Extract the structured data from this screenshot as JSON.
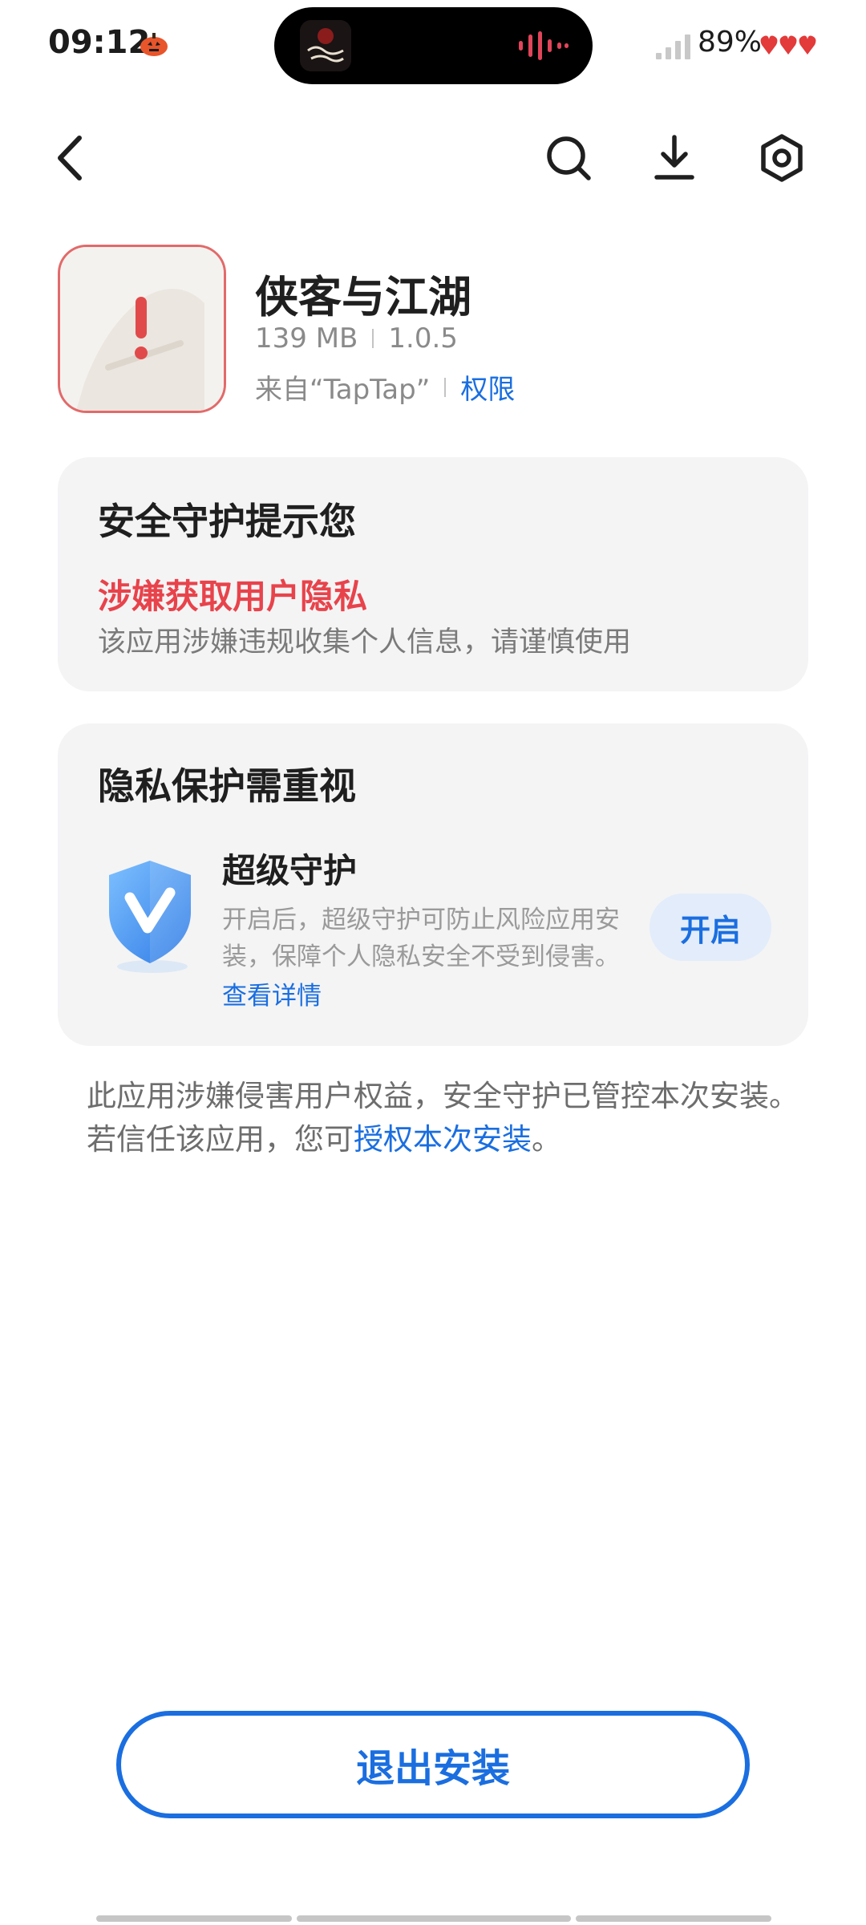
{
  "status_bar": {
    "time": "09:12",
    "battery": "89%",
    "notification_icon": "pumpkin-icon",
    "island_app_icon": "game-thumbnail-icon"
  },
  "nav": {
    "back_icon": "chevron-left-icon",
    "search_icon": "search-icon",
    "download_icon": "download-icon",
    "settings_icon": "gear-icon"
  },
  "app": {
    "name": "侠客与江湖",
    "size": "139 MB",
    "version": "1.0.5",
    "source": "来自“TapTap”",
    "permissions_link": "权限"
  },
  "warning_card": {
    "title": "安全守护提示您",
    "risk_title": "涉嫌获取用户隐私",
    "risk_desc": "该应用涉嫌违规收集个人信息，请谨慎使用"
  },
  "privacy_card": {
    "title": "隐私保护需重视",
    "feature_title": "超级守护",
    "feature_desc": "开启后，超级守护可防止风险应用安装，保障个人隐私安全不受到侵害。",
    "feature_link": "查看详情",
    "enable_button": "开启"
  },
  "notice": {
    "text_before": "此应用涉嫌侵害用户权益，安全守护已管控本次安装。若信任该应用，您可",
    "link": "授权本次安装",
    "text_after": "。"
  },
  "footer": {
    "exit_button": "退出安装"
  },
  "colors": {
    "accent": "#1a6ee0",
    "danger": "#e8434b",
    "card_bg": "#f4f4f5"
  }
}
